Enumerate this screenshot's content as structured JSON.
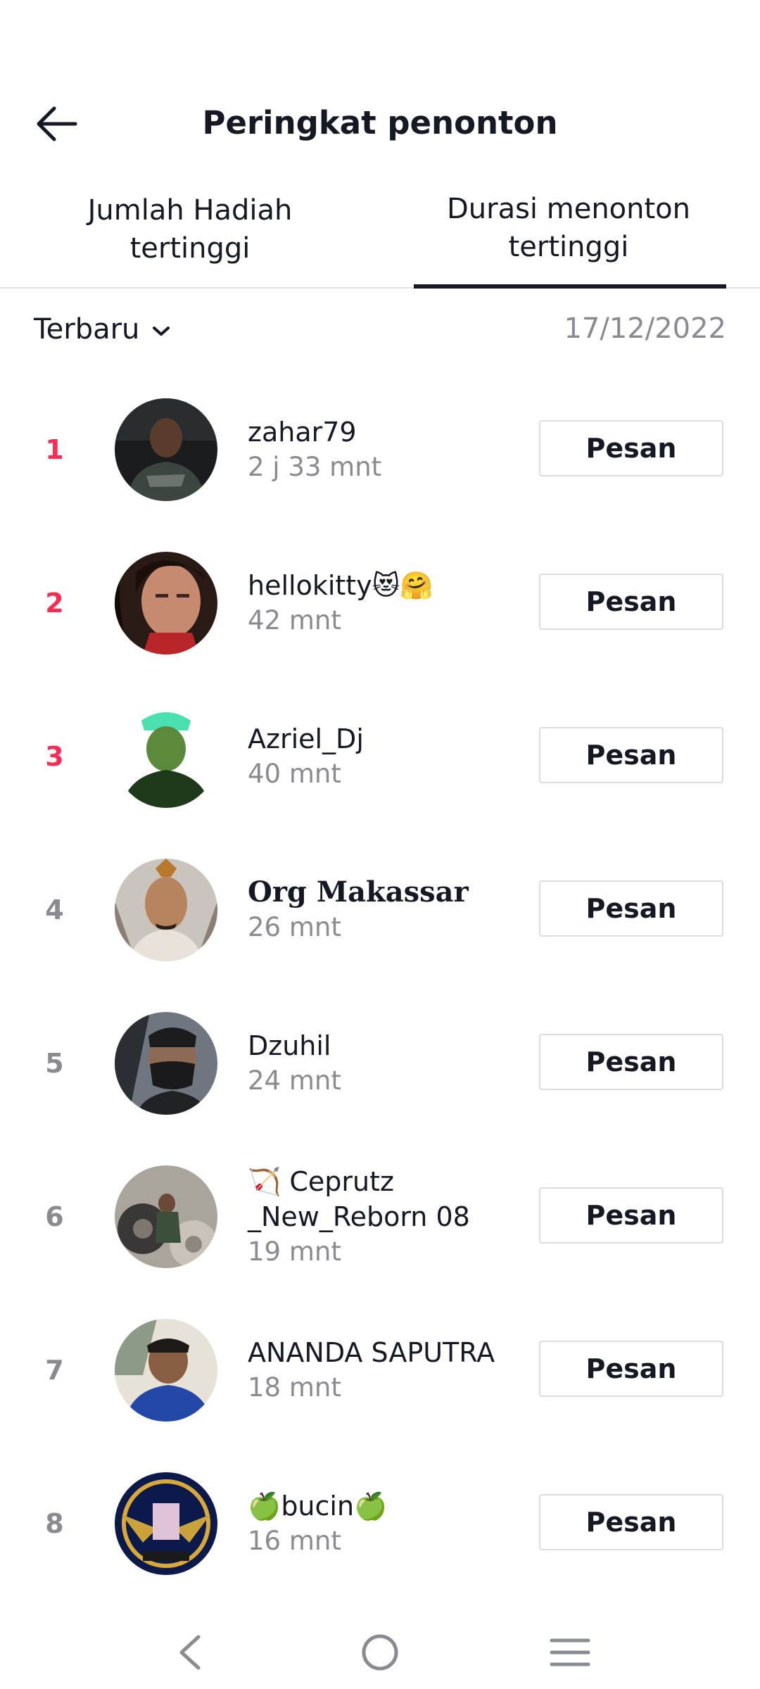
{
  "header": {
    "title": "Peringkat penonton"
  },
  "tabs": [
    {
      "label_line1": "Jumlah Hadiah",
      "label_line2": "tertinggi"
    },
    {
      "label_line1": "Durasi menonton",
      "label_line2": "tertinggi"
    }
  ],
  "filter": {
    "label": "Terbaru",
    "date": "17/12/2022"
  },
  "viewers": [
    {
      "rank": "1",
      "name": "zahar79",
      "duration": "2 j 33 mnt",
      "button": "Pesan"
    },
    {
      "rank": "2",
      "name": "hellokitty😻🤗",
      "duration": "42 mnt",
      "button": "Pesan"
    },
    {
      "rank": "3",
      "name": "Azriel_Dj",
      "duration": "40 mnt",
      "button": "Pesan"
    },
    {
      "rank": "4",
      "name": "Org Makassar",
      "duration": "26 mnt",
      "button": "Pesan"
    },
    {
      "rank": "5",
      "name": "Dzuhil",
      "duration": "24 mnt",
      "button": "Pesan"
    },
    {
      "rank": "6",
      "name": "🏹 Ceprutz _New_Reborn 08",
      "duration": "19 mnt",
      "button": "Pesan"
    },
    {
      "rank": "7",
      "name": "ANANDA SAPUTRA",
      "duration": "18 mnt",
      "button": "Pesan"
    },
    {
      "rank": "8",
      "name": "🍏bucin🍏",
      "duration": "16 mnt",
      "button": "Pesan"
    }
  ],
  "colors": {
    "accent": "#fe2c55",
    "text": "#161823",
    "secondary": "#8a8b91",
    "divider": "#e3e3e4"
  },
  "icons": {
    "back": "arrow-left-icon",
    "filter": "chevron-down-icon",
    "nav": [
      "nav-back-icon",
      "nav-home-icon",
      "nav-recents-icon"
    ]
  }
}
